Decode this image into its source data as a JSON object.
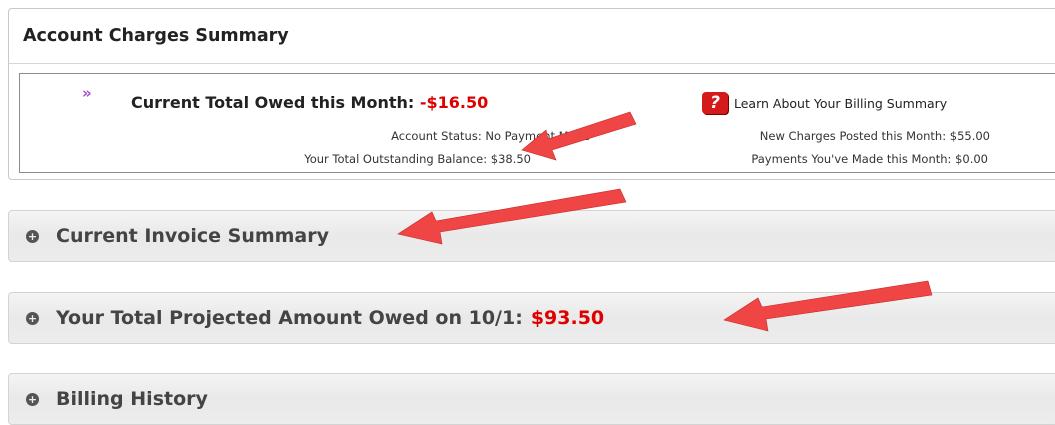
{
  "summary": {
    "header": "Account Charges Summary",
    "current_owed_label": "Current Total Owed this Month:",
    "current_owed_value": "-$16.50",
    "account_status": "Account Status: No Payment Made",
    "outstanding_balance": "Your Total Outstanding Balance: $38.50",
    "learn_link": "Learn About Your Billing Summary",
    "new_charges": "New Charges Posted this Month: $55.00",
    "payments_made": "Payments You've Made this Month: $0.00"
  },
  "sections": {
    "invoice": "Current Invoice Summary",
    "projected_label": "Your Total Projected Amount Owed on 10/1:",
    "projected_value": "$93.50",
    "history": "Billing History"
  },
  "icons": {
    "chevron": "chevron-right-double-icon",
    "help": "help-question-icon",
    "expand": "expand-circle-icon",
    "annotation": "red-arrow-annotation"
  },
  "colors": {
    "negative": "#e00000",
    "arrow": "#f04545",
    "chevron": "#a050c8"
  }
}
